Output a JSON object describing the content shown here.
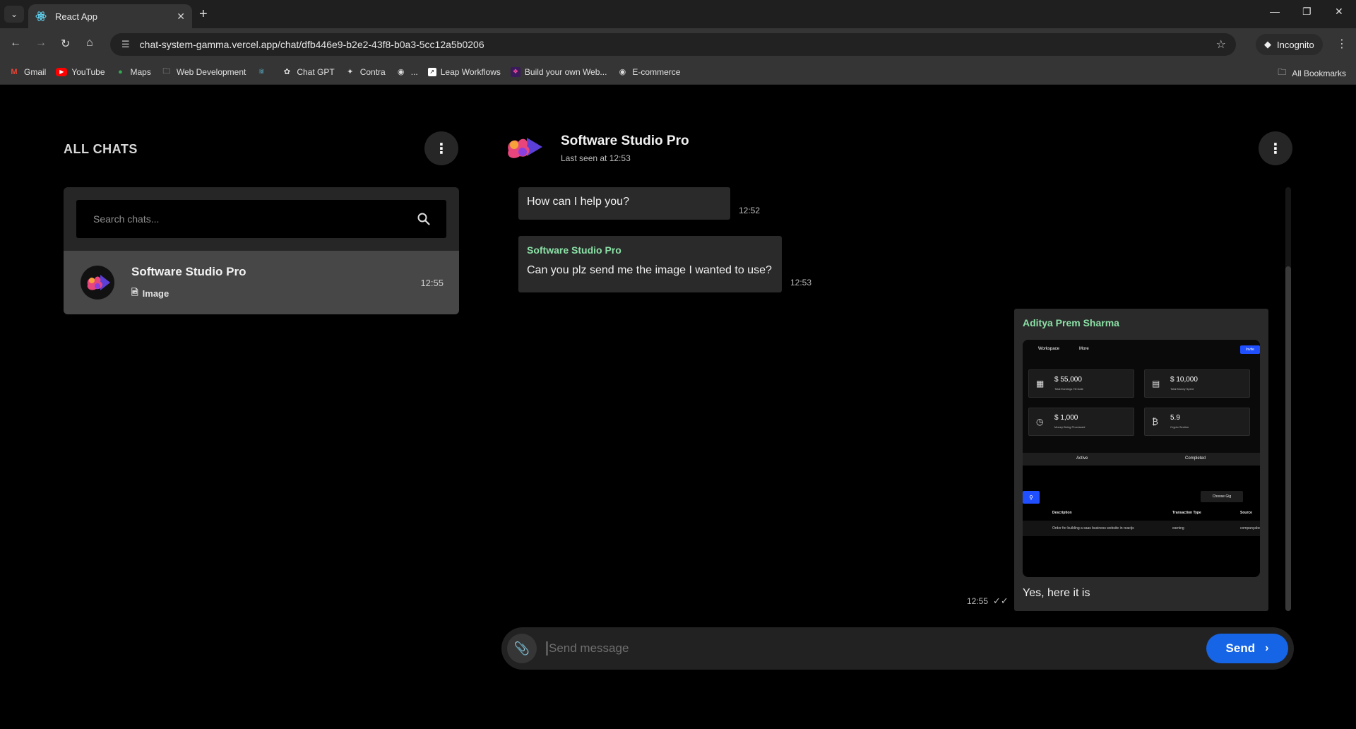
{
  "browser": {
    "tab_title": "React App",
    "url": "chat-system-gamma.vercel.app/chat/dfb446e9-b2e2-43f8-b0a3-5cc12a5b0206",
    "incognito_label": "Incognito",
    "bookmarks": [
      {
        "label": "Gmail",
        "icon": "gmail-icon"
      },
      {
        "label": "YouTube",
        "icon": "youtube-icon"
      },
      {
        "label": "Maps",
        "icon": "maps-icon"
      },
      {
        "label": "Web Development",
        "icon": "folder-icon"
      },
      {
        "label": "",
        "icon": "react-icon"
      },
      {
        "label": "Chat GPT",
        "icon": "chatgpt-icon"
      },
      {
        "label": "Contra",
        "icon": "contra-icon"
      },
      {
        "label": "...",
        "icon": "globe-icon"
      },
      {
        "label": "Leap Workflows",
        "icon": "leap-icon"
      },
      {
        "label": "Build your own Web...",
        "icon": "build-icon"
      },
      {
        "label": "E-commerce",
        "icon": "ecommerce-icon"
      }
    ],
    "all_bookmarks_label": "All Bookmarks"
  },
  "sidebar": {
    "title": "ALL CHATS",
    "search_placeholder": "Search chats...",
    "chats": [
      {
        "name": "Software Studio Pro",
        "preview": "Image",
        "time": "12:55"
      }
    ]
  },
  "chat": {
    "name": "Software Studio Pro",
    "last_seen": "Last seen at 12:53",
    "messages": [
      {
        "sender": "",
        "text": "How can I help you?",
        "time": "12:52"
      },
      {
        "sender": "Software Studio Pro",
        "text": "Can you plz send me the image I wanted to use?",
        "time": "12:53"
      },
      {
        "sender": "Aditya Prem Sharma",
        "text": "Yes, here it is",
        "time": "12:55"
      }
    ],
    "attachment": {
      "nav": [
        "Workspace",
        "More"
      ],
      "button": "Invite",
      "cards": [
        {
          "value": "$ 55,000",
          "label": "Total Earnings Till Date",
          "icon": "chart-icon"
        },
        {
          "value": "$ 10,000",
          "label": "Total Money Spent",
          "icon": "wallet-icon"
        },
        {
          "value": "$ 1,000",
          "label": "Money Being Processed",
          "icon": "clock-icon"
        },
        {
          "value": "5.9",
          "label": "Crypto Section",
          "icon": "bitcoin-icon"
        }
      ],
      "tabs": [
        "Active",
        "Completed"
      ],
      "choose": "Choose Gig",
      "headers": [
        "Description",
        "Transaction Type",
        "Source"
      ],
      "row": [
        "Order for building a saas business website in reactjs",
        "earning",
        "companyabc"
      ]
    },
    "composer_placeholder": "Send message",
    "send_label": "Send"
  }
}
